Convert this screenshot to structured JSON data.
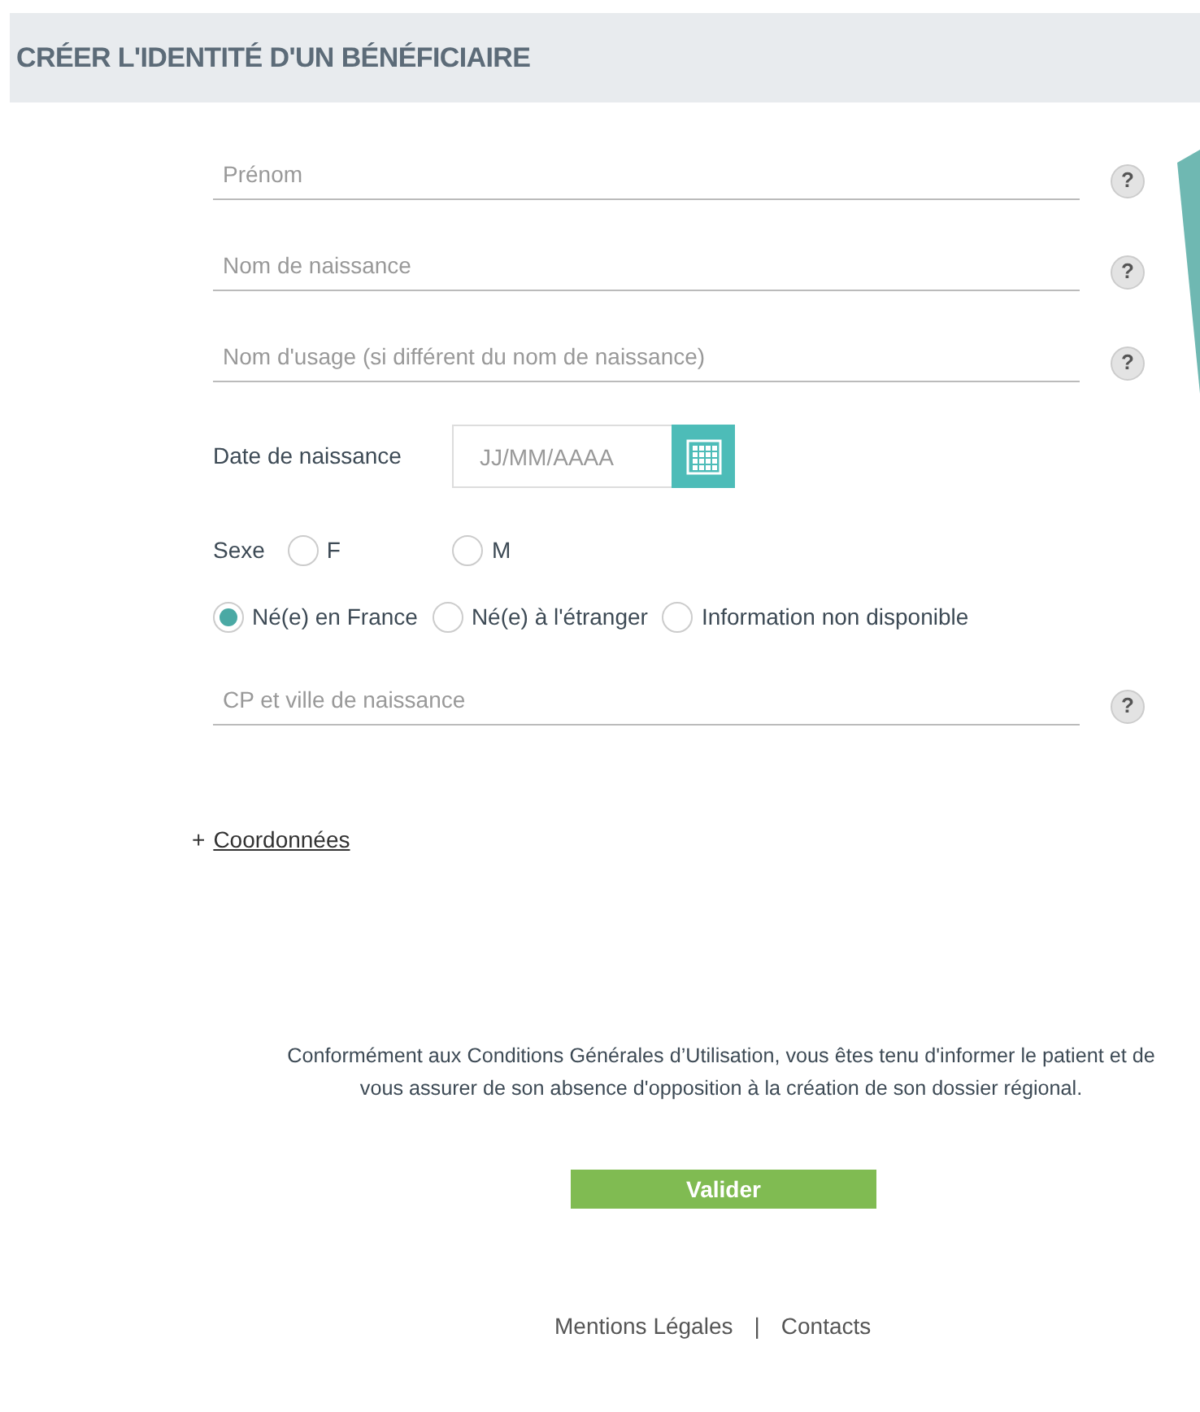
{
  "header": {
    "title": "CRÉER L'IDENTITÉ D'UN BÉNÉFICIAIRE"
  },
  "name_fields": [
    {
      "placeholder": "Prénom",
      "help": "?"
    },
    {
      "placeholder": "Nom de naissance",
      "help": "?"
    },
    {
      "placeholder": "Nom d'usage (si différent du nom de naissance)",
      "help": "?"
    }
  ],
  "birth_date": {
    "label": "Date de naissance",
    "placeholder": "JJ/MM/AAAA"
  },
  "sex": {
    "label": "Sexe",
    "options": [
      {
        "label": "F",
        "selected": false
      },
      {
        "label": "M",
        "selected": false
      }
    ]
  },
  "birth_place": {
    "options": [
      {
        "label": "Né(e) en France",
        "selected": true
      },
      {
        "label": "Né(e) à l'étranger",
        "selected": false
      },
      {
        "label": "Information non disponible",
        "selected": false
      }
    ]
  },
  "birth_city_field": {
    "placeholder": "CP et ville de naissance",
    "help": "?"
  },
  "coordinates_link": {
    "prefix": "+",
    "label": "Coordonnées"
  },
  "notice": "Conformément aux Conditions Générales d’Utilisation, vous êtes tenu d'informer le patient et de vous assurer de son absence d'opposition à la création de son dossier régional.",
  "submit_button": "Valider",
  "footer": {
    "links": [
      "Mentions Légales",
      "Contacts"
    ],
    "separator": "|"
  }
}
